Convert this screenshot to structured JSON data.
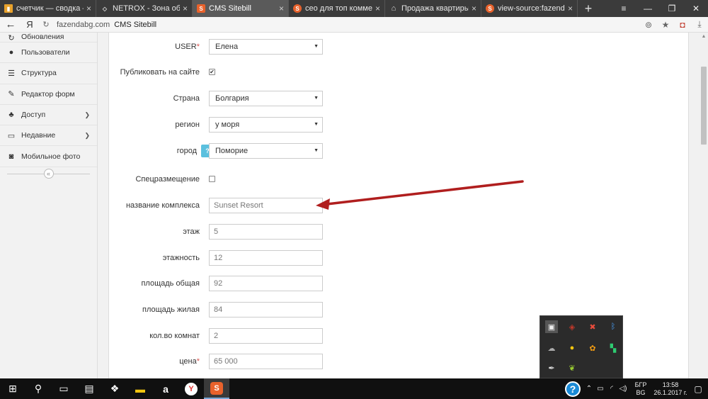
{
  "browser": {
    "tabs": [
      {
        "title": "счетчик — сводка — Янд",
        "icon_color": "#e8a22c",
        "active": false
      },
      {
        "title": "NETROX - Зона общения",
        "icon_color": "#888888",
        "active": false
      },
      {
        "title": "CMS Sitebill",
        "icon_color": "#e8622c",
        "active": true
      },
      {
        "title": "сео для топ коммерческ",
        "icon_color": "#e8622c",
        "active": false
      },
      {
        "title": "Продажа квартиры в Бол",
        "icon_color": "#888888",
        "active": false
      },
      {
        "title": "view-source:fazendabg.co",
        "icon_color": "#e8622c",
        "active": false
      }
    ],
    "new_tab": "+",
    "address": {
      "ya": "Я",
      "url": "fazendabg.com",
      "site_title": "CMS Sitebill"
    }
  },
  "sidebar": {
    "items": [
      {
        "label": "Обновления",
        "icon": "refresh-icon",
        "has_chevron": false
      },
      {
        "label": "Пользователи",
        "icon": "user-icon",
        "has_chevron": false
      },
      {
        "label": "Структура",
        "icon": "list-icon",
        "has_chevron": false
      },
      {
        "label": "Редактор форм",
        "icon": "edit-icon",
        "has_chevron": false
      },
      {
        "label": "Доступ",
        "icon": "users-icon",
        "has_chevron": true
      },
      {
        "label": "Недавние",
        "icon": "monitor-icon",
        "has_chevron": true
      },
      {
        "label": "Мобильное фото",
        "icon": "camera-icon",
        "has_chevron": false
      }
    ],
    "collapse": "«"
  },
  "form": {
    "user": {
      "label": "USER",
      "value": "Елена"
    },
    "publish": {
      "label": "Публиковать на сайте",
      "checked": true
    },
    "country": {
      "label": "Страна",
      "value": "Болгария"
    },
    "region": {
      "label": "регион",
      "value": "у моря"
    },
    "city": {
      "label": "город",
      "value": "Поморие",
      "help": "?"
    },
    "special": {
      "label": "Спецразмещение",
      "checked": false
    },
    "complex": {
      "label": "название комплекса",
      "value": "Sunset Resort"
    },
    "floor": {
      "label": "этаж",
      "value": "5"
    },
    "floors": {
      "label": "этажность",
      "value": "12"
    },
    "area_total": {
      "label": "площадь общая",
      "value": "92"
    },
    "area_living": {
      "label": "площадь жилая",
      "value": "84"
    },
    "rooms": {
      "label": "кол.во комнат",
      "value": "2"
    },
    "price": {
      "label": "цена",
      "value": "65 000"
    },
    "required_mark": "*"
  },
  "annotation": {
    "arrow_color": "#b01e1e"
  },
  "taskbar": {
    "lang_line1": "БГР",
    "lang_line2": "BG",
    "time": "13:58",
    "date": "26.1.2017 г."
  }
}
